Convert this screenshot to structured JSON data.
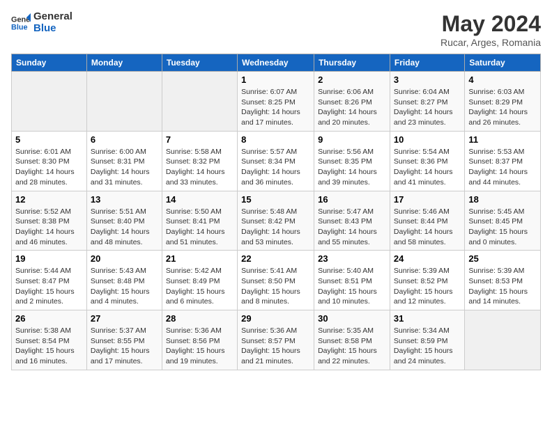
{
  "header": {
    "logo_general": "General",
    "logo_blue": "Blue",
    "month_year": "May 2024",
    "location": "Rucar, Arges, Romania"
  },
  "days_of_week": [
    "Sunday",
    "Monday",
    "Tuesday",
    "Wednesday",
    "Thursday",
    "Friday",
    "Saturday"
  ],
  "weeks": [
    [
      {
        "day": "",
        "info": ""
      },
      {
        "day": "",
        "info": ""
      },
      {
        "day": "",
        "info": ""
      },
      {
        "day": "1",
        "info": "Sunrise: 6:07 AM\nSunset: 8:25 PM\nDaylight: 14 hours\nand 17 minutes."
      },
      {
        "day": "2",
        "info": "Sunrise: 6:06 AM\nSunset: 8:26 PM\nDaylight: 14 hours\nand 20 minutes."
      },
      {
        "day": "3",
        "info": "Sunrise: 6:04 AM\nSunset: 8:27 PM\nDaylight: 14 hours\nand 23 minutes."
      },
      {
        "day": "4",
        "info": "Sunrise: 6:03 AM\nSunset: 8:29 PM\nDaylight: 14 hours\nand 26 minutes."
      }
    ],
    [
      {
        "day": "5",
        "info": "Sunrise: 6:01 AM\nSunset: 8:30 PM\nDaylight: 14 hours\nand 28 minutes."
      },
      {
        "day": "6",
        "info": "Sunrise: 6:00 AM\nSunset: 8:31 PM\nDaylight: 14 hours\nand 31 minutes."
      },
      {
        "day": "7",
        "info": "Sunrise: 5:58 AM\nSunset: 8:32 PM\nDaylight: 14 hours\nand 33 minutes."
      },
      {
        "day": "8",
        "info": "Sunrise: 5:57 AM\nSunset: 8:34 PM\nDaylight: 14 hours\nand 36 minutes."
      },
      {
        "day": "9",
        "info": "Sunrise: 5:56 AM\nSunset: 8:35 PM\nDaylight: 14 hours\nand 39 minutes."
      },
      {
        "day": "10",
        "info": "Sunrise: 5:54 AM\nSunset: 8:36 PM\nDaylight: 14 hours\nand 41 minutes."
      },
      {
        "day": "11",
        "info": "Sunrise: 5:53 AM\nSunset: 8:37 PM\nDaylight: 14 hours\nand 44 minutes."
      }
    ],
    [
      {
        "day": "12",
        "info": "Sunrise: 5:52 AM\nSunset: 8:38 PM\nDaylight: 14 hours\nand 46 minutes."
      },
      {
        "day": "13",
        "info": "Sunrise: 5:51 AM\nSunset: 8:40 PM\nDaylight: 14 hours\nand 48 minutes."
      },
      {
        "day": "14",
        "info": "Sunrise: 5:50 AM\nSunset: 8:41 PM\nDaylight: 14 hours\nand 51 minutes."
      },
      {
        "day": "15",
        "info": "Sunrise: 5:48 AM\nSunset: 8:42 PM\nDaylight: 14 hours\nand 53 minutes."
      },
      {
        "day": "16",
        "info": "Sunrise: 5:47 AM\nSunset: 8:43 PM\nDaylight: 14 hours\nand 55 minutes."
      },
      {
        "day": "17",
        "info": "Sunrise: 5:46 AM\nSunset: 8:44 PM\nDaylight: 14 hours\nand 58 minutes."
      },
      {
        "day": "18",
        "info": "Sunrise: 5:45 AM\nSunset: 8:45 PM\nDaylight: 15 hours\nand 0 minutes."
      }
    ],
    [
      {
        "day": "19",
        "info": "Sunrise: 5:44 AM\nSunset: 8:47 PM\nDaylight: 15 hours\nand 2 minutes."
      },
      {
        "day": "20",
        "info": "Sunrise: 5:43 AM\nSunset: 8:48 PM\nDaylight: 15 hours\nand 4 minutes."
      },
      {
        "day": "21",
        "info": "Sunrise: 5:42 AM\nSunset: 8:49 PM\nDaylight: 15 hours\nand 6 minutes."
      },
      {
        "day": "22",
        "info": "Sunrise: 5:41 AM\nSunset: 8:50 PM\nDaylight: 15 hours\nand 8 minutes."
      },
      {
        "day": "23",
        "info": "Sunrise: 5:40 AM\nSunset: 8:51 PM\nDaylight: 15 hours\nand 10 minutes."
      },
      {
        "day": "24",
        "info": "Sunrise: 5:39 AM\nSunset: 8:52 PM\nDaylight: 15 hours\nand 12 minutes."
      },
      {
        "day": "25",
        "info": "Sunrise: 5:39 AM\nSunset: 8:53 PM\nDaylight: 15 hours\nand 14 minutes."
      }
    ],
    [
      {
        "day": "26",
        "info": "Sunrise: 5:38 AM\nSunset: 8:54 PM\nDaylight: 15 hours\nand 16 minutes."
      },
      {
        "day": "27",
        "info": "Sunrise: 5:37 AM\nSunset: 8:55 PM\nDaylight: 15 hours\nand 17 minutes."
      },
      {
        "day": "28",
        "info": "Sunrise: 5:36 AM\nSunset: 8:56 PM\nDaylight: 15 hours\nand 19 minutes."
      },
      {
        "day": "29",
        "info": "Sunrise: 5:36 AM\nSunset: 8:57 PM\nDaylight: 15 hours\nand 21 minutes."
      },
      {
        "day": "30",
        "info": "Sunrise: 5:35 AM\nSunset: 8:58 PM\nDaylight: 15 hours\nand 22 minutes."
      },
      {
        "day": "31",
        "info": "Sunrise: 5:34 AM\nSunset: 8:59 PM\nDaylight: 15 hours\nand 24 minutes."
      },
      {
        "day": "",
        "info": ""
      }
    ]
  ]
}
